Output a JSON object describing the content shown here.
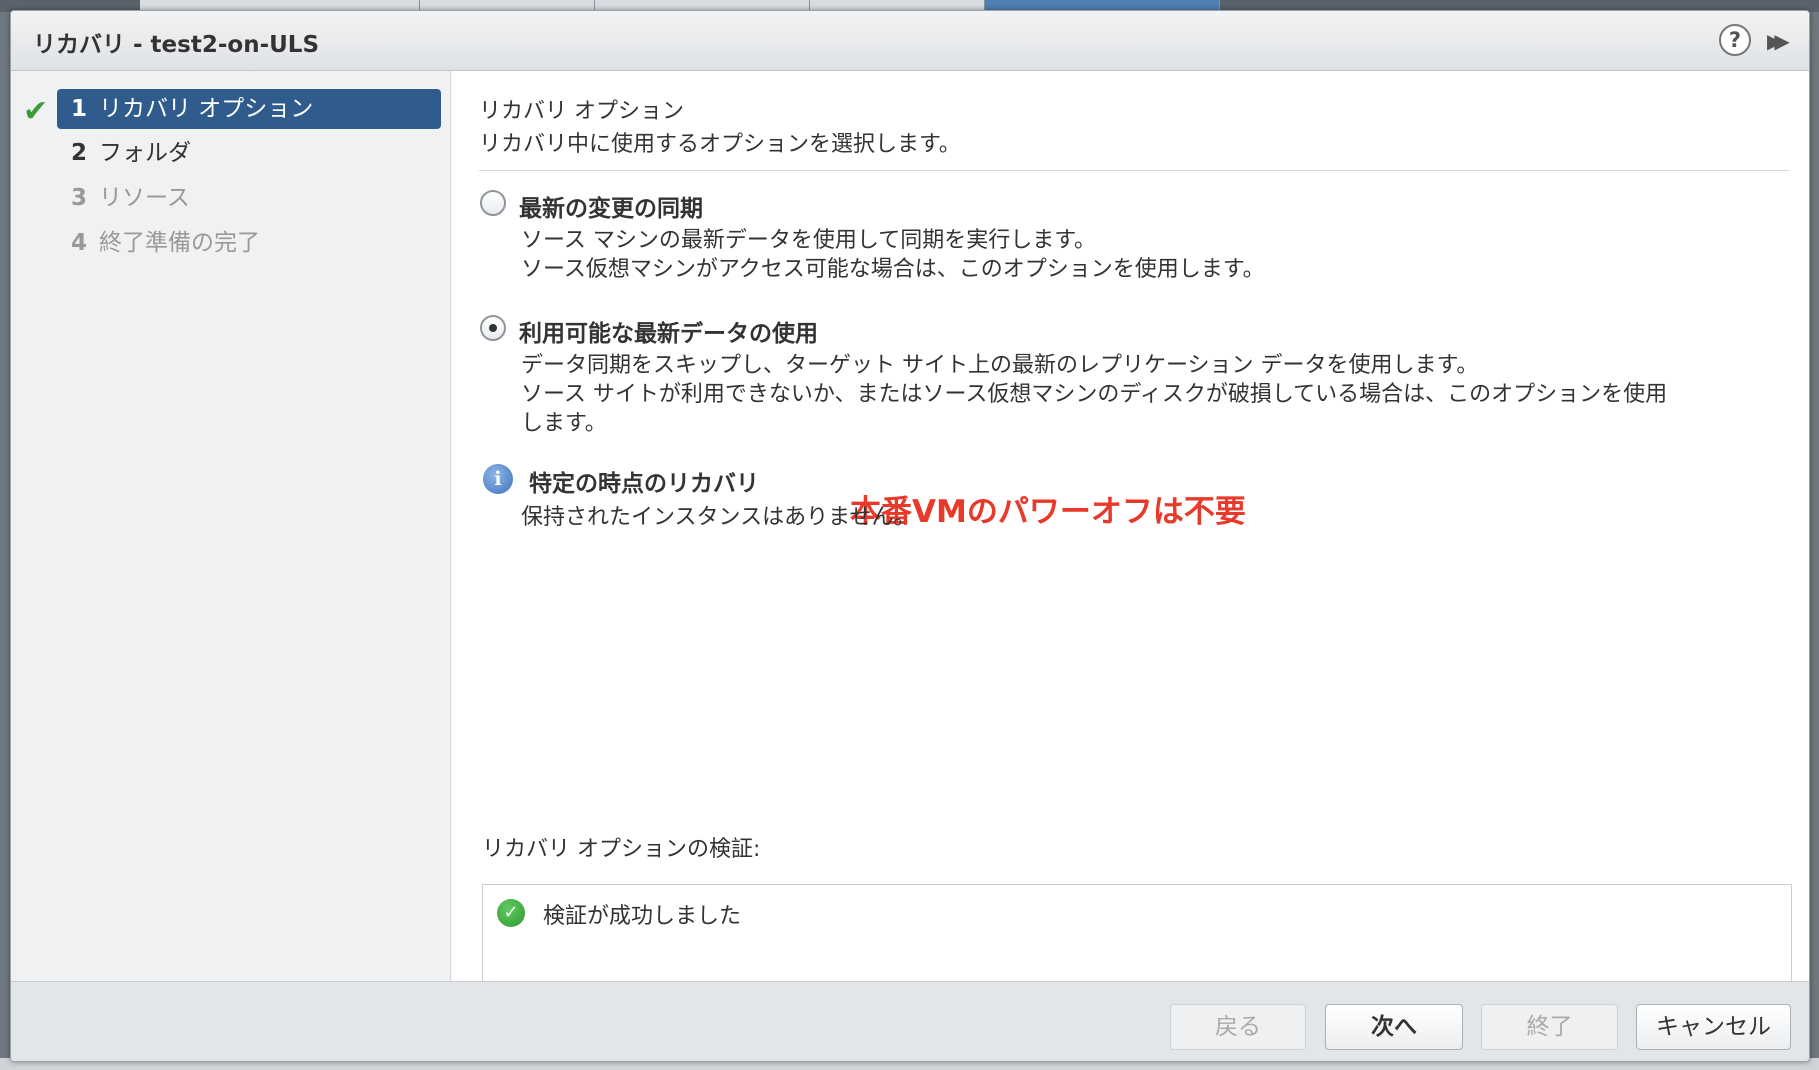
{
  "dialog": {
    "title": "リカバリ - test2-on-ULS",
    "help_icon": "?",
    "forward_icon": "▶▶"
  },
  "sidebar": {
    "steps": [
      {
        "num": "1",
        "label": "リカバリ オプション",
        "state": "active"
      },
      {
        "num": "2",
        "label": "フォルダ",
        "state": "enabled"
      },
      {
        "num": "3",
        "label": "リソース",
        "state": "disabled"
      },
      {
        "num": "4",
        "label": "終了準備の完了",
        "state": "disabled"
      }
    ],
    "check_icon": "✔"
  },
  "main": {
    "title": "リカバリ オプション",
    "description": "リカバリ中に使用するオプションを選択します。",
    "options": [
      {
        "label": "最新の変更の同期",
        "selected": false,
        "desc_lines": [
          "ソース マシンの最新データを使用して同期を実行します。",
          "ソース仮想マシンがアクセス可能な場合は、このオプションを使用します。"
        ]
      },
      {
        "label": "利用可能な最新データの使用",
        "selected": true,
        "desc_lines": [
          "データ同期をスキップし、ターゲット サイト上の最新のレプリケーション データを使用します。",
          "ソース サイトが利用できないか、またはソース仮想マシンのディスクが破損している場合は、このオプションを使用",
          "します。"
        ]
      }
    ],
    "point_in_time": {
      "label": "特定の時点のリカバリ",
      "info_icon": "i",
      "message": "保持されたインスタンスはありません。"
    },
    "annotation": "本番VMのパワーオフは不要",
    "validation": {
      "label": "リカバリ オプションの検証:",
      "result": "検証が成功しました",
      "ok_icon": "✓"
    }
  },
  "footer": {
    "back": "戻る",
    "next": "次へ",
    "finish": "終了",
    "cancel": "キャンセル"
  }
}
